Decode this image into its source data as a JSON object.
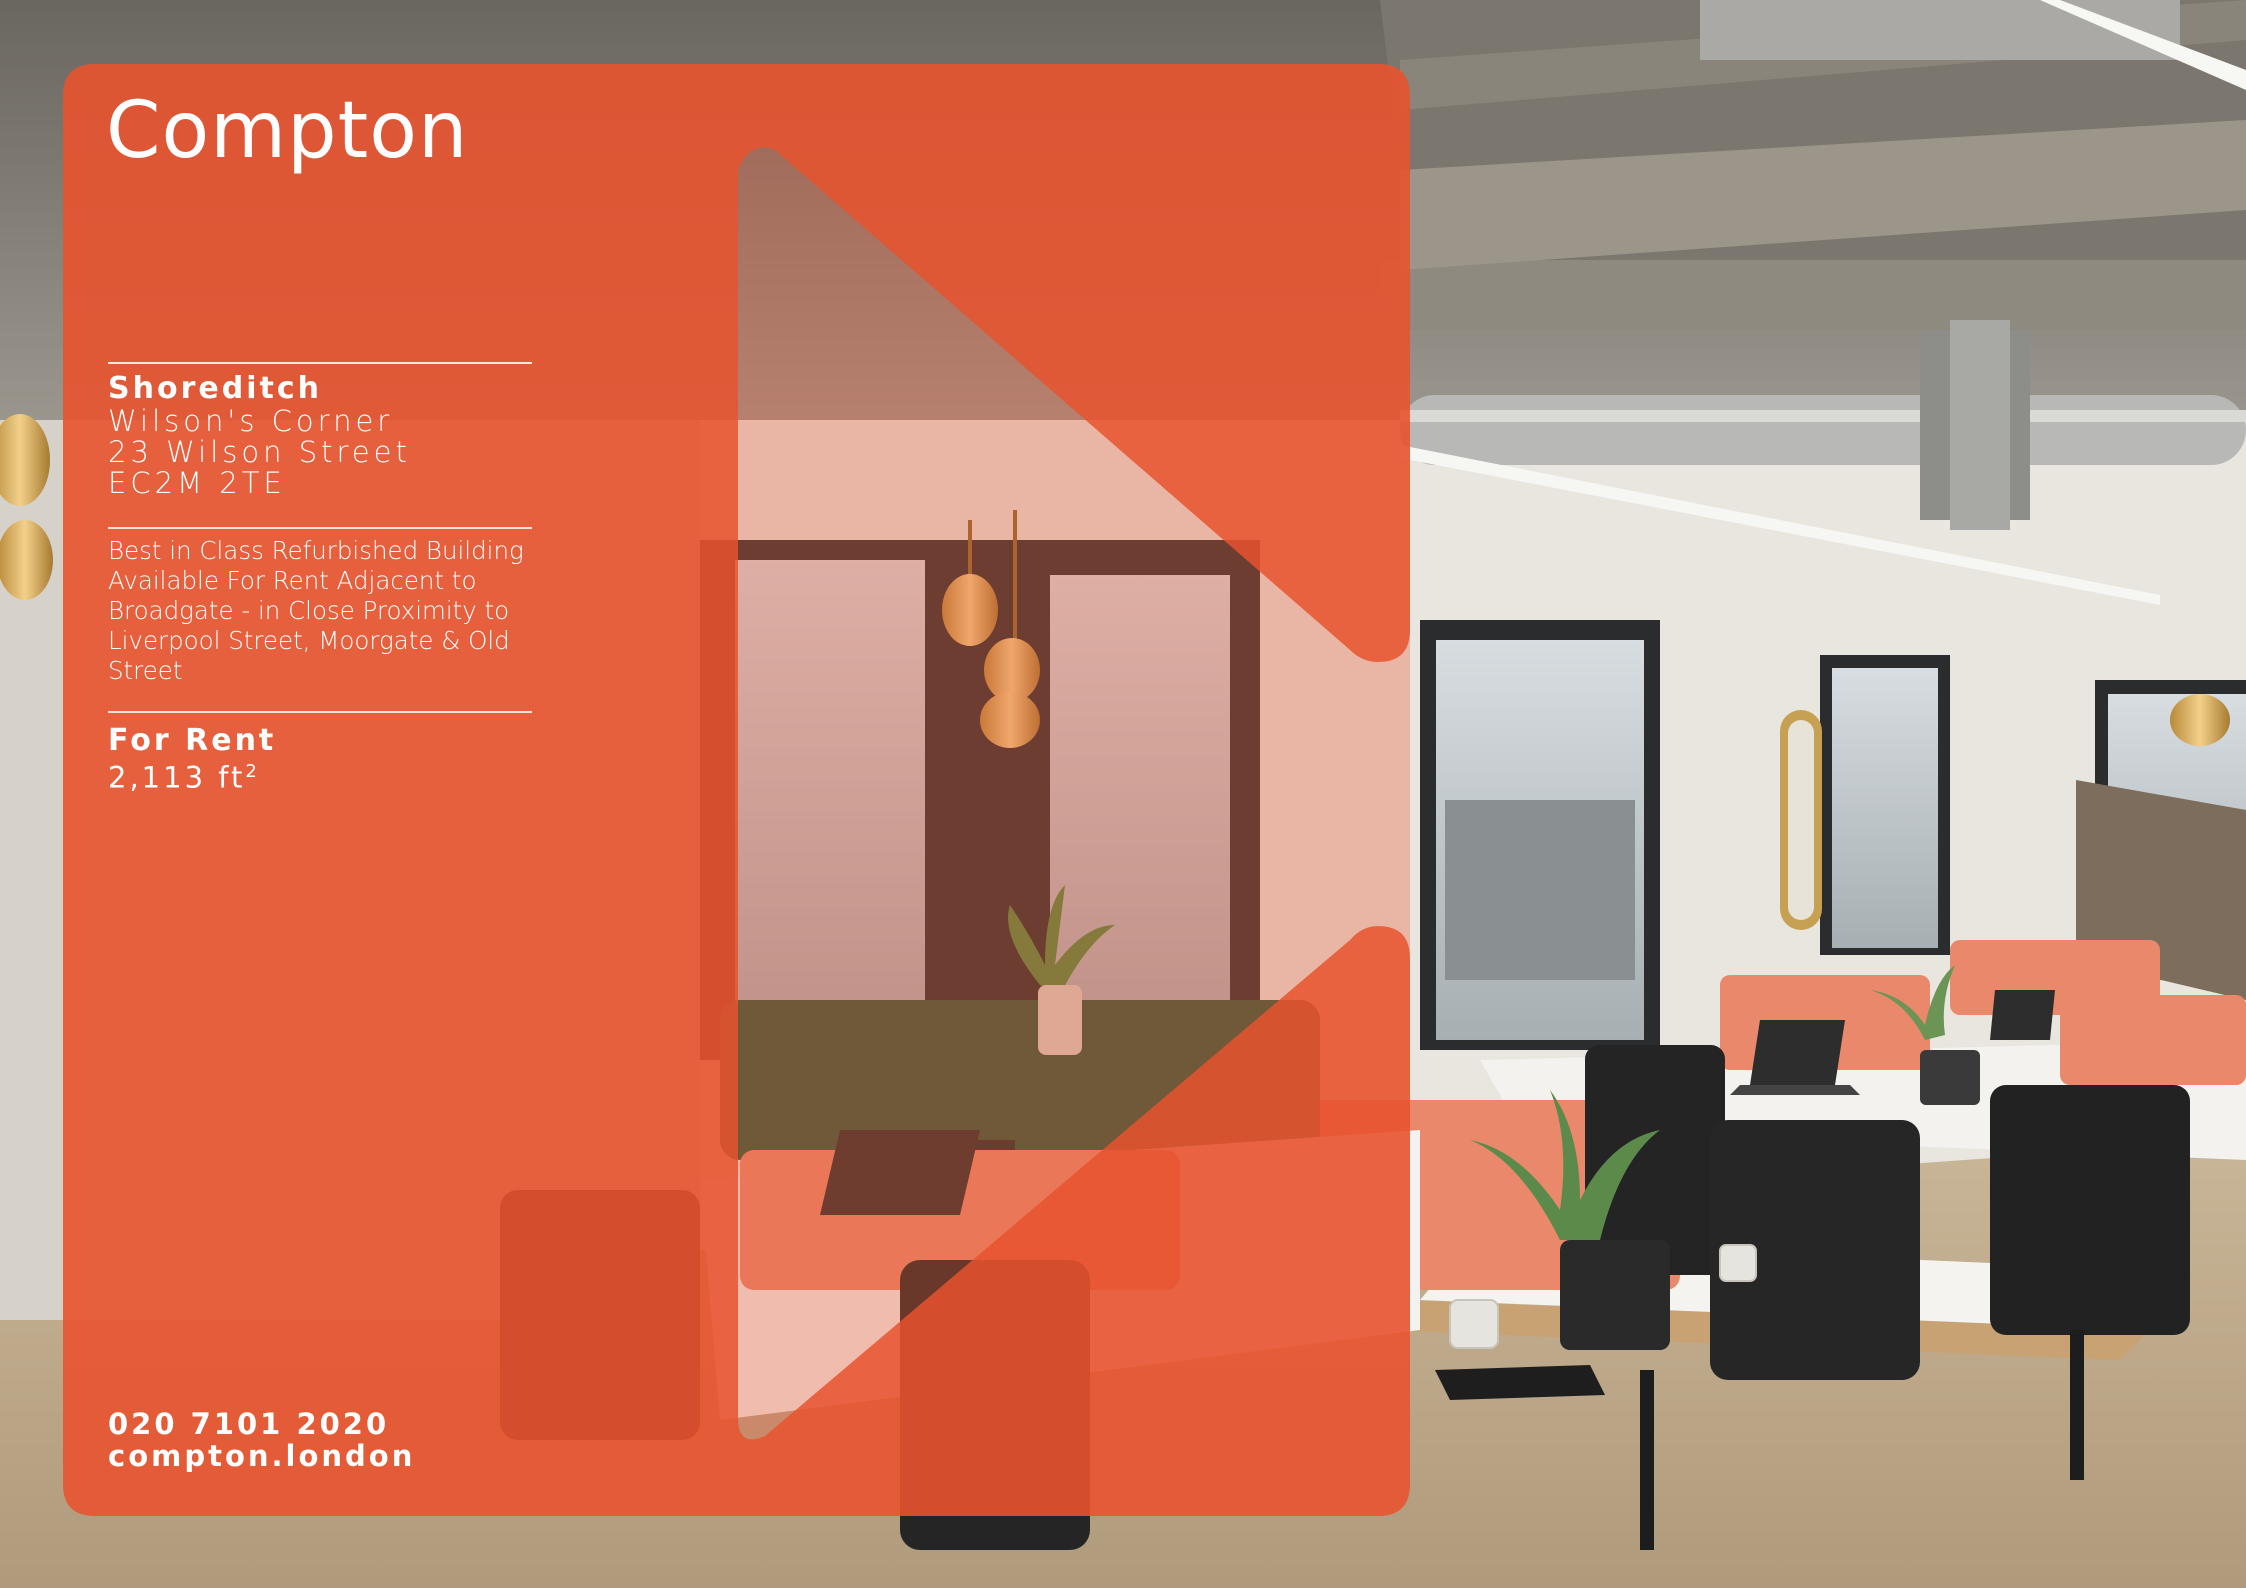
{
  "brand": {
    "name": "Compton",
    "accent": "#e8532f"
  },
  "location": {
    "area": "Shoreditch",
    "building": "Wilson's Corner",
    "street": "23 Wilson Street",
    "postcode": "EC2M 2TE"
  },
  "description": "Best in Class Refurbished Building Available For Rent Adjacent to Broadgate - in Close Proximity to Liverpool Street, Moorgate & Old Street",
  "listing": {
    "type": "For Rent",
    "size": "2,113 ft",
    "unit_sup": "2"
  },
  "contact": {
    "phone": "020 7101 2020",
    "website": "compton.london"
  }
}
